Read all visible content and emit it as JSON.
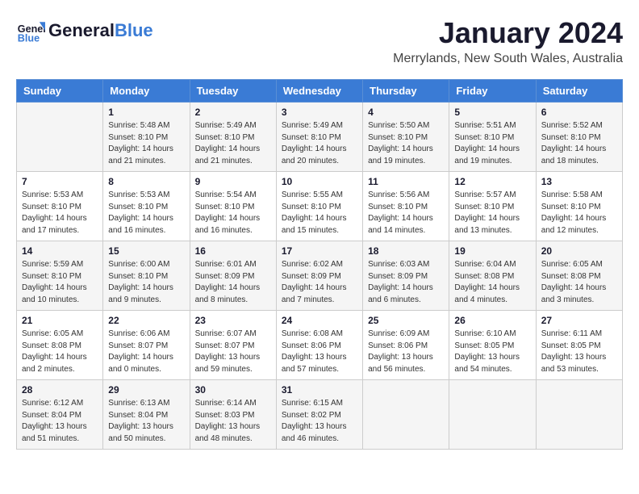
{
  "header": {
    "logo_text_general": "General",
    "logo_text_blue": "Blue",
    "title": "January 2024",
    "subtitle": "Merrylands, New South Wales, Australia"
  },
  "calendar": {
    "days_of_week": [
      "Sunday",
      "Monday",
      "Tuesday",
      "Wednesday",
      "Thursday",
      "Friday",
      "Saturday"
    ],
    "weeks": [
      [
        {
          "day": "",
          "info": ""
        },
        {
          "day": "1",
          "info": "Sunrise: 5:48 AM\nSunset: 8:10 PM\nDaylight: 14 hours\nand 21 minutes."
        },
        {
          "day": "2",
          "info": "Sunrise: 5:49 AM\nSunset: 8:10 PM\nDaylight: 14 hours\nand 21 minutes."
        },
        {
          "day": "3",
          "info": "Sunrise: 5:49 AM\nSunset: 8:10 PM\nDaylight: 14 hours\nand 20 minutes."
        },
        {
          "day": "4",
          "info": "Sunrise: 5:50 AM\nSunset: 8:10 PM\nDaylight: 14 hours\nand 19 minutes."
        },
        {
          "day": "5",
          "info": "Sunrise: 5:51 AM\nSunset: 8:10 PM\nDaylight: 14 hours\nand 19 minutes."
        },
        {
          "day": "6",
          "info": "Sunrise: 5:52 AM\nSunset: 8:10 PM\nDaylight: 14 hours\nand 18 minutes."
        }
      ],
      [
        {
          "day": "7",
          "info": "Sunrise: 5:53 AM\nSunset: 8:10 PM\nDaylight: 14 hours\nand 17 minutes."
        },
        {
          "day": "8",
          "info": "Sunrise: 5:53 AM\nSunset: 8:10 PM\nDaylight: 14 hours\nand 16 minutes."
        },
        {
          "day": "9",
          "info": "Sunrise: 5:54 AM\nSunset: 8:10 PM\nDaylight: 14 hours\nand 16 minutes."
        },
        {
          "day": "10",
          "info": "Sunrise: 5:55 AM\nSunset: 8:10 PM\nDaylight: 14 hours\nand 15 minutes."
        },
        {
          "day": "11",
          "info": "Sunrise: 5:56 AM\nSunset: 8:10 PM\nDaylight: 14 hours\nand 14 minutes."
        },
        {
          "day": "12",
          "info": "Sunrise: 5:57 AM\nSunset: 8:10 PM\nDaylight: 14 hours\nand 13 minutes."
        },
        {
          "day": "13",
          "info": "Sunrise: 5:58 AM\nSunset: 8:10 PM\nDaylight: 14 hours\nand 12 minutes."
        }
      ],
      [
        {
          "day": "14",
          "info": "Sunrise: 5:59 AM\nSunset: 8:10 PM\nDaylight: 14 hours\nand 10 minutes."
        },
        {
          "day": "15",
          "info": "Sunrise: 6:00 AM\nSunset: 8:10 PM\nDaylight: 14 hours\nand 9 minutes."
        },
        {
          "day": "16",
          "info": "Sunrise: 6:01 AM\nSunset: 8:09 PM\nDaylight: 14 hours\nand 8 minutes."
        },
        {
          "day": "17",
          "info": "Sunrise: 6:02 AM\nSunset: 8:09 PM\nDaylight: 14 hours\nand 7 minutes."
        },
        {
          "day": "18",
          "info": "Sunrise: 6:03 AM\nSunset: 8:09 PM\nDaylight: 14 hours\nand 6 minutes."
        },
        {
          "day": "19",
          "info": "Sunrise: 6:04 AM\nSunset: 8:08 PM\nDaylight: 14 hours\nand 4 minutes."
        },
        {
          "day": "20",
          "info": "Sunrise: 6:05 AM\nSunset: 8:08 PM\nDaylight: 14 hours\nand 3 minutes."
        }
      ],
      [
        {
          "day": "21",
          "info": "Sunrise: 6:05 AM\nSunset: 8:08 PM\nDaylight: 14 hours\nand 2 minutes."
        },
        {
          "day": "22",
          "info": "Sunrise: 6:06 AM\nSunset: 8:07 PM\nDaylight: 14 hours\nand 0 minutes."
        },
        {
          "day": "23",
          "info": "Sunrise: 6:07 AM\nSunset: 8:07 PM\nDaylight: 13 hours\nand 59 minutes."
        },
        {
          "day": "24",
          "info": "Sunrise: 6:08 AM\nSunset: 8:06 PM\nDaylight: 13 hours\nand 57 minutes."
        },
        {
          "day": "25",
          "info": "Sunrise: 6:09 AM\nSunset: 8:06 PM\nDaylight: 13 hours\nand 56 minutes."
        },
        {
          "day": "26",
          "info": "Sunrise: 6:10 AM\nSunset: 8:05 PM\nDaylight: 13 hours\nand 54 minutes."
        },
        {
          "day": "27",
          "info": "Sunrise: 6:11 AM\nSunset: 8:05 PM\nDaylight: 13 hours\nand 53 minutes."
        }
      ],
      [
        {
          "day": "28",
          "info": "Sunrise: 6:12 AM\nSunset: 8:04 PM\nDaylight: 13 hours\nand 51 minutes."
        },
        {
          "day": "29",
          "info": "Sunrise: 6:13 AM\nSunset: 8:04 PM\nDaylight: 13 hours\nand 50 minutes."
        },
        {
          "day": "30",
          "info": "Sunrise: 6:14 AM\nSunset: 8:03 PM\nDaylight: 13 hours\nand 48 minutes."
        },
        {
          "day": "31",
          "info": "Sunrise: 6:15 AM\nSunset: 8:02 PM\nDaylight: 13 hours\nand 46 minutes."
        },
        {
          "day": "",
          "info": ""
        },
        {
          "day": "",
          "info": ""
        },
        {
          "day": "",
          "info": ""
        }
      ]
    ]
  }
}
